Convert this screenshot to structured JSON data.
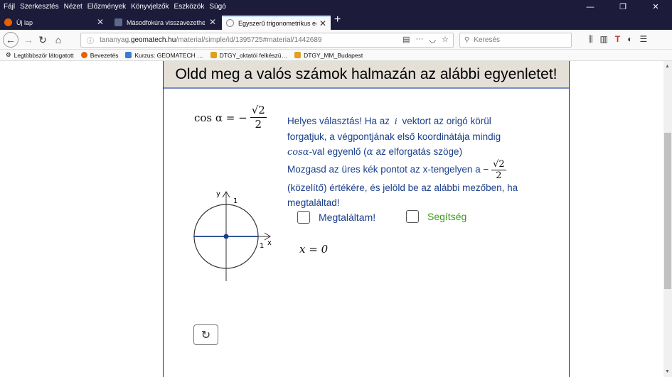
{
  "menu": [
    "Fájl",
    "Szerkesztés",
    "Nézet",
    "Előzmények",
    "Könyvjelzők",
    "Eszközök",
    "Súgó"
  ],
  "window_controls": [
    "—",
    "❐",
    "✕"
  ],
  "tabs": [
    {
      "label": "Új lap",
      "active": false,
      "color": "#e66000"
    },
    {
      "label": "Másodfokúra visszavezethető t…",
      "active": false,
      "color": "#5a6a8a"
    },
    {
      "label": "Egyszerű trigonometrikus egye…",
      "active": true,
      "color": "#888888"
    }
  ],
  "newtab_label": "+",
  "url": {
    "prefix": "tananyag.",
    "host": "geomatech.hu",
    "path": "/material/simple/id/1395725#material/1442689"
  },
  "search_placeholder": "Keresés",
  "bookmarks": [
    {
      "label": "Legtöbbször látogatott",
      "color": "#555555"
    },
    {
      "label": "Bevezetés",
      "color": "#e66000"
    },
    {
      "label": "Kurzus: GEOMATECH …",
      "color": "#3a7bd5"
    },
    {
      "label": "DTGY_oktatói felkészü…",
      "color": "#e0a020"
    },
    {
      "label": "DTGY_MM_Budapest",
      "color": "#e0a020"
    }
  ],
  "applet": {
    "title": "Oldd meg a valós számok halmazán az alábbi egyenletet!",
    "equation": {
      "lhs": "cos α = −",
      "num": "√2",
      "den": "2"
    },
    "feedback": {
      "p1": "Helyes választás! Ha az",
      "vec": "i",
      "p2": "vektort az origó körül forgatjuk, a végpontjának első koordinátája mindig",
      "cos": "cosα",
      "p3": "-val egyenlő (",
      "alpha": "α",
      "p4": "az elforgatás szöge)",
      "p5": "Mozgasd az üres kék pontot az x-tengelyen a",
      "frac_num": "√2",
      "frac_den": "2",
      "minus": "−",
      "p6": "(közelítő) értékére, és jelöld be az alábbi mezőben, ha megtaláltad!"
    },
    "checkbox_found": "Megtaláltam!",
    "checkbox_help": "Segítség",
    "x_value": "x = 0",
    "axis_labels": {
      "y": "y",
      "x": "x",
      "one_top": "1",
      "one_right": "1"
    },
    "reset_icon": "↻"
  },
  "colors": {
    "feedback": "#1a3e8a",
    "help": "#3a9a1a",
    "header_bg": "#e4e0d8",
    "axis_point": "#1a3e8a"
  }
}
